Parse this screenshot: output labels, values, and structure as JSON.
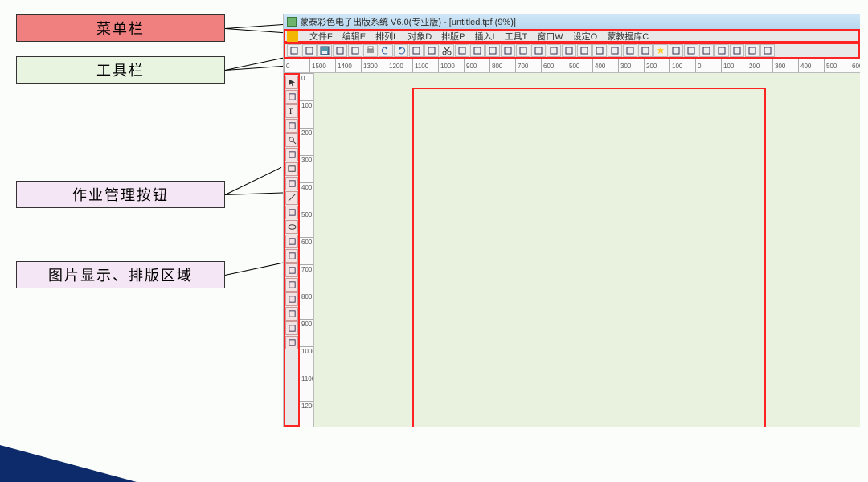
{
  "annotations": {
    "menu": "菜单栏",
    "toolbar": "工具栏",
    "jobs": "作业管理按钮",
    "canvas": "图片显示、排版区域"
  },
  "titlebar": {
    "icon_name": "app-icon",
    "text": "蒙泰彩色电子出版系统 V6.0(专业版) - [untitled.tpf (9%)]"
  },
  "menubar": {
    "items": [
      "文件F",
      "编辑E",
      "排列L",
      "对象D",
      "排版P",
      "插入I",
      "工具T",
      "窗口W",
      "设定O",
      "蒙教据库C"
    ]
  },
  "h_toolbar_icons": [
    "open-icon",
    "monitor-icon",
    "save-icon",
    "import-icon",
    "export-icon",
    "print-icon",
    "undo-icon",
    "redo-icon",
    "zoom-in-icon",
    "zoom-out-icon",
    "cut-icon",
    "copy-icon",
    "paste-icon",
    "properties-icon",
    "group-icon",
    "ungroup-icon",
    "align-left-icon",
    "align-center-icon",
    "align-right-icon",
    "to-front-icon",
    "to-back-icon",
    "tile-icon",
    "link-icon",
    "color-dropper-icon",
    "star-icon",
    "measure-icon",
    "settings-icon",
    "text-frame-icon",
    "grid-icon",
    "crop-icon",
    "artboard-icon",
    "layers-icon"
  ],
  "v_toolbar_icons": [
    "select-icon",
    "direct-select-icon",
    "text-icon",
    "text-vertical-icon",
    "zoom-icon",
    "pan-icon",
    "rectangle-icon",
    "text-box-icon",
    "line-icon",
    "rect-frame-icon",
    "ellipse-frame-icon",
    "polygon-icon",
    "wave-icon",
    "bezier-icon",
    "crop-tool-icon",
    "table-icon",
    "curve-icon",
    "freeform-icon",
    "measure-tool-icon"
  ],
  "ruler": {
    "h_start": -1500,
    "tick_step": 100,
    "h_labels": [
      "0",
      "1500",
      "1400",
      "1300",
      "1200",
      "1100",
      "1000",
      "900",
      "800",
      "700",
      "600",
      "500",
      "400",
      "300",
      "200",
      "100",
      "0",
      "100",
      "200",
      "300",
      "400",
      "500",
      "600"
    ],
    "v_labels": [
      "0",
      "100",
      "200",
      "300",
      "400",
      "500",
      "600",
      "700",
      "800",
      "900",
      "1000",
      "1100",
      "1200"
    ]
  },
  "chart_data": {
    "type": "none"
  },
  "colors": {
    "highlight_box": "#ff2222",
    "canvas_bg": "#e9f2de",
    "anno_pink": "#f5e6f5",
    "anno_red": "#f08080",
    "anno_green": "#e8f3e0"
  }
}
